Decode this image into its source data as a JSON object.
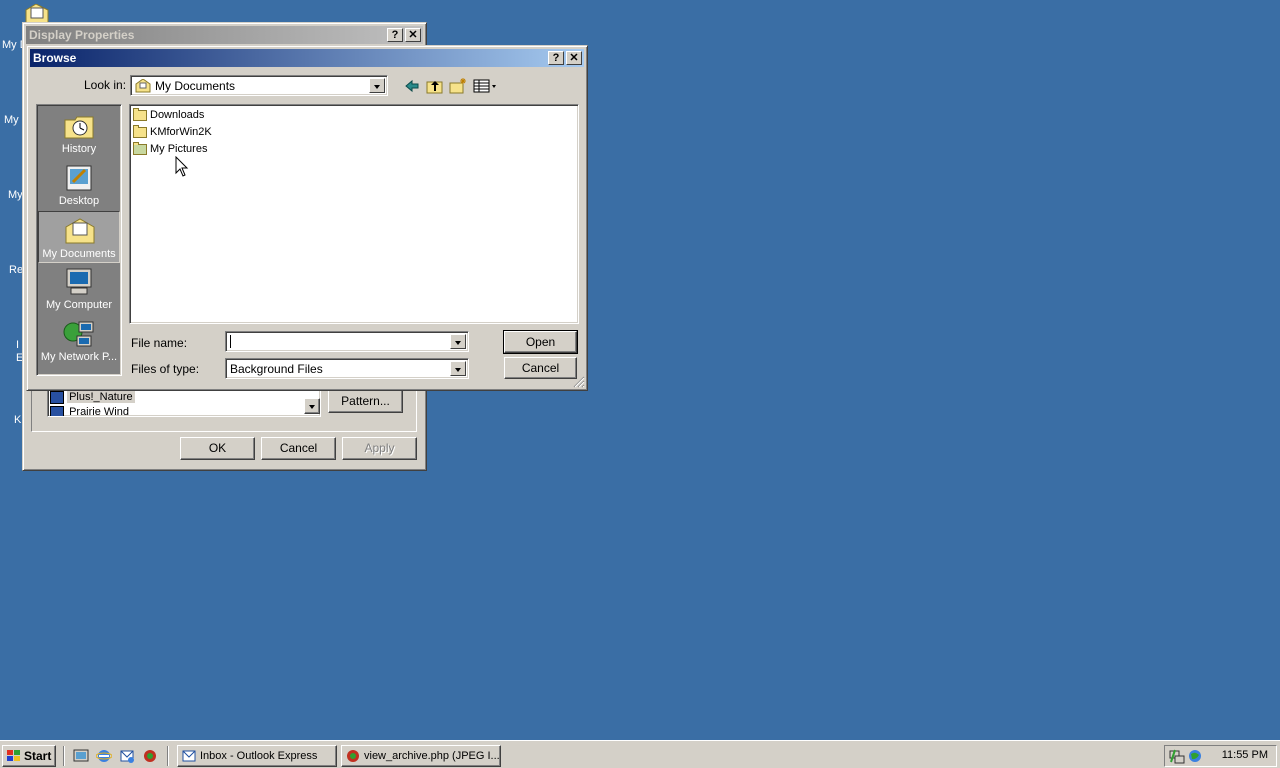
{
  "desktop": {
    "icon_labels": [
      "My D",
      "My",
      "My",
      "Re",
      "I",
      "E",
      "K"
    ]
  },
  "display_properties": {
    "title": "Display Properties",
    "help_btn": "?",
    "close_btn": "✕",
    "wallpaper_items": [
      "Plus!_Nature",
      "Prairie Wind"
    ],
    "pattern_button": "Pattern...",
    "ok_button": "OK",
    "cancel_button": "Cancel",
    "apply_button": "Apply"
  },
  "browse": {
    "title": "Browse",
    "help_btn": "?",
    "close_btn": "✕",
    "look_in_label": "Look in:",
    "look_in_value": "My Documents",
    "places": [
      {
        "label": "History",
        "icon": "history-icon"
      },
      {
        "label": "Desktop",
        "icon": "desktop-icon"
      },
      {
        "label": "My Documents",
        "icon": "my-documents-icon"
      },
      {
        "label": "My Computer",
        "icon": "my-computer-icon"
      },
      {
        "label": "My Network P...",
        "icon": "my-network-places-icon"
      }
    ],
    "files": [
      {
        "name": "Downloads",
        "icon": "folder-icon"
      },
      {
        "name": "KMforWin2K",
        "icon": "folder-icon"
      },
      {
        "name": "My Pictures",
        "icon": "pictures-folder-icon"
      }
    ],
    "file_name_label": "File name:",
    "file_name_value": "",
    "files_of_type_label": "Files of type:",
    "files_of_type_value": "Background Files",
    "open_button": "Open",
    "cancel_button": "Cancel"
  },
  "taskbar": {
    "start_label": "Start",
    "tasks": [
      {
        "label": "Inbox - Outlook Express",
        "icon": "outlook-express-icon"
      },
      {
        "label": "view_archive.php (JPEG I...",
        "icon": "browser-icon"
      }
    ],
    "clock": "11:55 PM"
  },
  "colors": {
    "desktop": "#3a6ea5",
    "active_title_start": "#0a246a",
    "active_title_end": "#a6caf0",
    "face": "#d4d0c8"
  }
}
